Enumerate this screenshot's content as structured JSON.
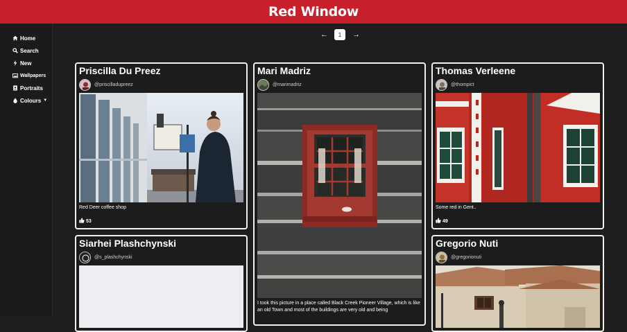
{
  "header": {
    "title": "Red Window"
  },
  "sidebar": {
    "items": [
      {
        "label": "Home",
        "icon": "home-icon"
      },
      {
        "label": "Search",
        "icon": "search-icon"
      },
      {
        "label": "New",
        "icon": "bolt-icon"
      },
      {
        "label": "Wallpapers",
        "icon": "image-icon"
      },
      {
        "label": "Portraits",
        "icon": "portrait-icon"
      },
      {
        "label": "Colours",
        "icon": "droplet-icon",
        "has_caret": true
      }
    ]
  },
  "pager": {
    "current_page": "1",
    "prev_icon": "arrow-left-icon",
    "next_icon": "arrow-right-icon"
  },
  "cards": [
    {
      "name": "Priscilla Du Preez",
      "handle": "@priscilladupreez",
      "caption": "Red Deer coffee shop",
      "likes": "53"
    },
    {
      "name": "Mari Madriz",
      "handle": "@marimadriz",
      "caption": "I took this picture in a place called Black Creek Pioneer Village, which is like an old Town and most of the buildings are very old and being"
    },
    {
      "name": "Thomas Verleene",
      "handle": "@thompict",
      "caption": "Some red in Gent..",
      "likes": "49"
    },
    {
      "name": "Siarhei Plashchynski",
      "handle": "@s_plashchynski"
    },
    {
      "name": "Gregorio Nuti",
      "handle": "@gregorionuti"
    }
  ],
  "colors": {
    "header_bg": "#c8202a",
    "page_bg": "#1e1e1e",
    "card_border": "#f1f1f1"
  }
}
